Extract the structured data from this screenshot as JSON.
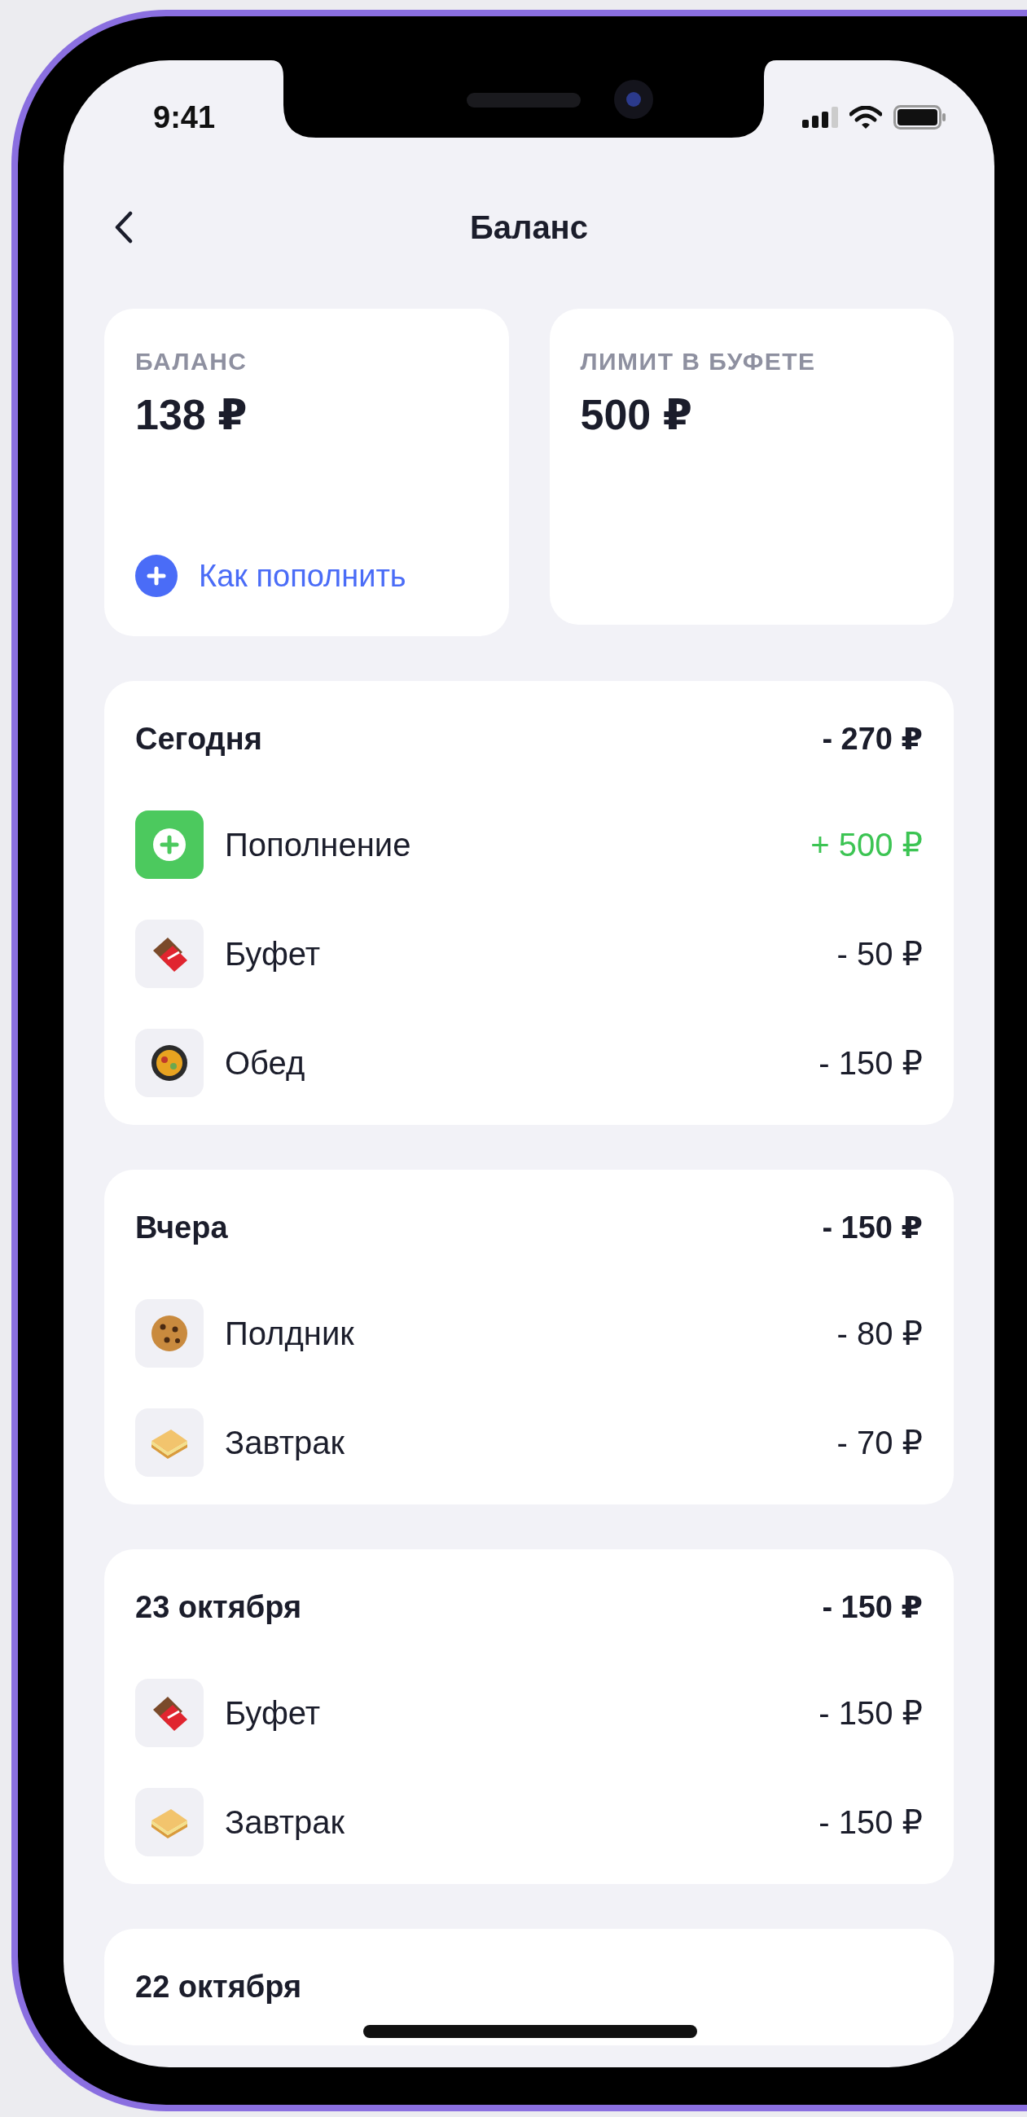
{
  "status_bar": {
    "time": "9:41"
  },
  "nav": {
    "title": "Баланс"
  },
  "summary": [
    {
      "label": "БАЛАНС",
      "amount": "138 ₽",
      "link": "Как пополнить"
    },
    {
      "label": "ЛИМИТ В БУФЕТЕ",
      "amount": "500 ₽"
    }
  ],
  "groups": [
    {
      "title": "Сегодня",
      "total": "- 270 ₽",
      "items": [
        {
          "kind": "topup",
          "label": "Пополнение",
          "amount": "+ 500 ₽",
          "income": true
        },
        {
          "kind": "chocolate",
          "label": "Буфет",
          "amount": "- 50 ₽",
          "income": false
        },
        {
          "kind": "pan",
          "label": "Обед",
          "amount": "- 150 ₽",
          "income": false
        }
      ]
    },
    {
      "title": "Вчера",
      "total": "- 150 ₽",
      "items": [
        {
          "kind": "cookie",
          "label": "Полдник",
          "amount": "- 80 ₽",
          "income": false
        },
        {
          "kind": "sandwich",
          "label": "Завтрак",
          "amount": "- 70 ₽",
          "income": false
        }
      ]
    },
    {
      "title": "23 октября",
      "total": "- 150 ₽",
      "items": [
        {
          "kind": "chocolate",
          "label": "Буфет",
          "amount": "- 150 ₽",
          "income": false
        },
        {
          "kind": "sandwich",
          "label": "Завтрак",
          "amount": "- 150 ₽",
          "income": false
        }
      ]
    },
    {
      "title": "22 октября"
    }
  ]
}
